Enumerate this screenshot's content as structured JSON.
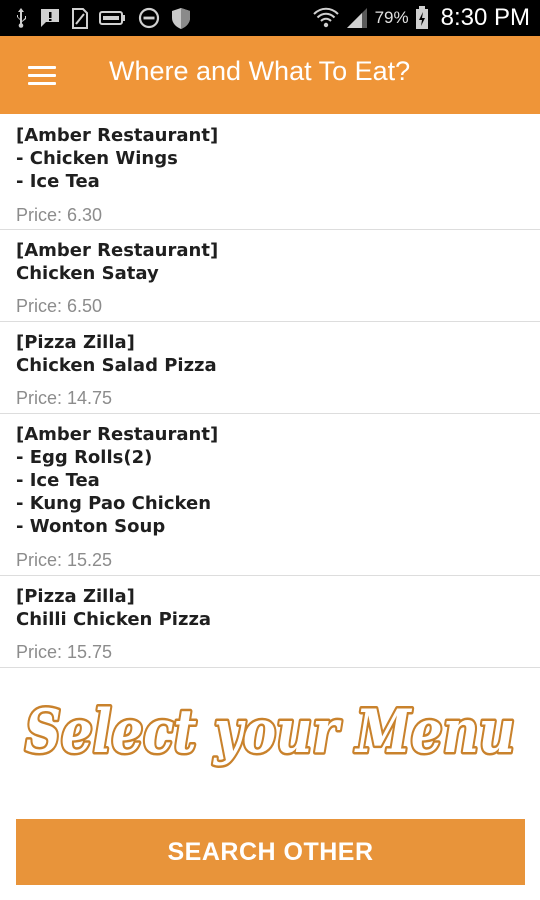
{
  "status_bar": {
    "left_icons": [
      "usb-icon",
      "message-icon",
      "sim-icon",
      "battery-saver-icon",
      "do-not-disturb-icon",
      "shield-icon"
    ],
    "right_icons": [
      "wifi-icon",
      "signal-icon",
      "battery-icon"
    ],
    "battery_percent": "79%",
    "time": "8:30 PM"
  },
  "app_bar": {
    "title": "Where and What To Eat?",
    "menu_icon": "hamburger-menu-icon",
    "color": "#ef9538"
  },
  "menu_items": [
    {
      "restaurant": "[Amber Restaurant]",
      "dishes": [
        "- Chicken Wings",
        "- Ice Tea"
      ],
      "price": "Price: 6.30"
    },
    {
      "restaurant": "[Amber Restaurant]",
      "dishes": [
        "Chicken Satay"
      ],
      "price": "Price: 6.50"
    },
    {
      "restaurant": "[Pizza Zilla]",
      "dishes": [
        "Chicken Salad Pizza"
      ],
      "price": "Price: 14.75"
    },
    {
      "restaurant": "[Amber Restaurant]",
      "dishes": [
        "- Egg Rolls(2)",
        "- Ice Tea",
        "- Kung Pao Chicken",
        "- Wonton Soup"
      ],
      "price": "Price: 15.25"
    },
    {
      "restaurant": "[Pizza Zilla]",
      "dishes": [
        "Chilli Chicken Pizza"
      ],
      "price": "Price: 15.75"
    }
  ],
  "banner": {
    "text": "Select your Menu",
    "fill_color": "#ffffff",
    "outline_color": "#c9822c"
  },
  "search_button": {
    "label": "SEARCH OTHER",
    "color": "#e8943a"
  }
}
